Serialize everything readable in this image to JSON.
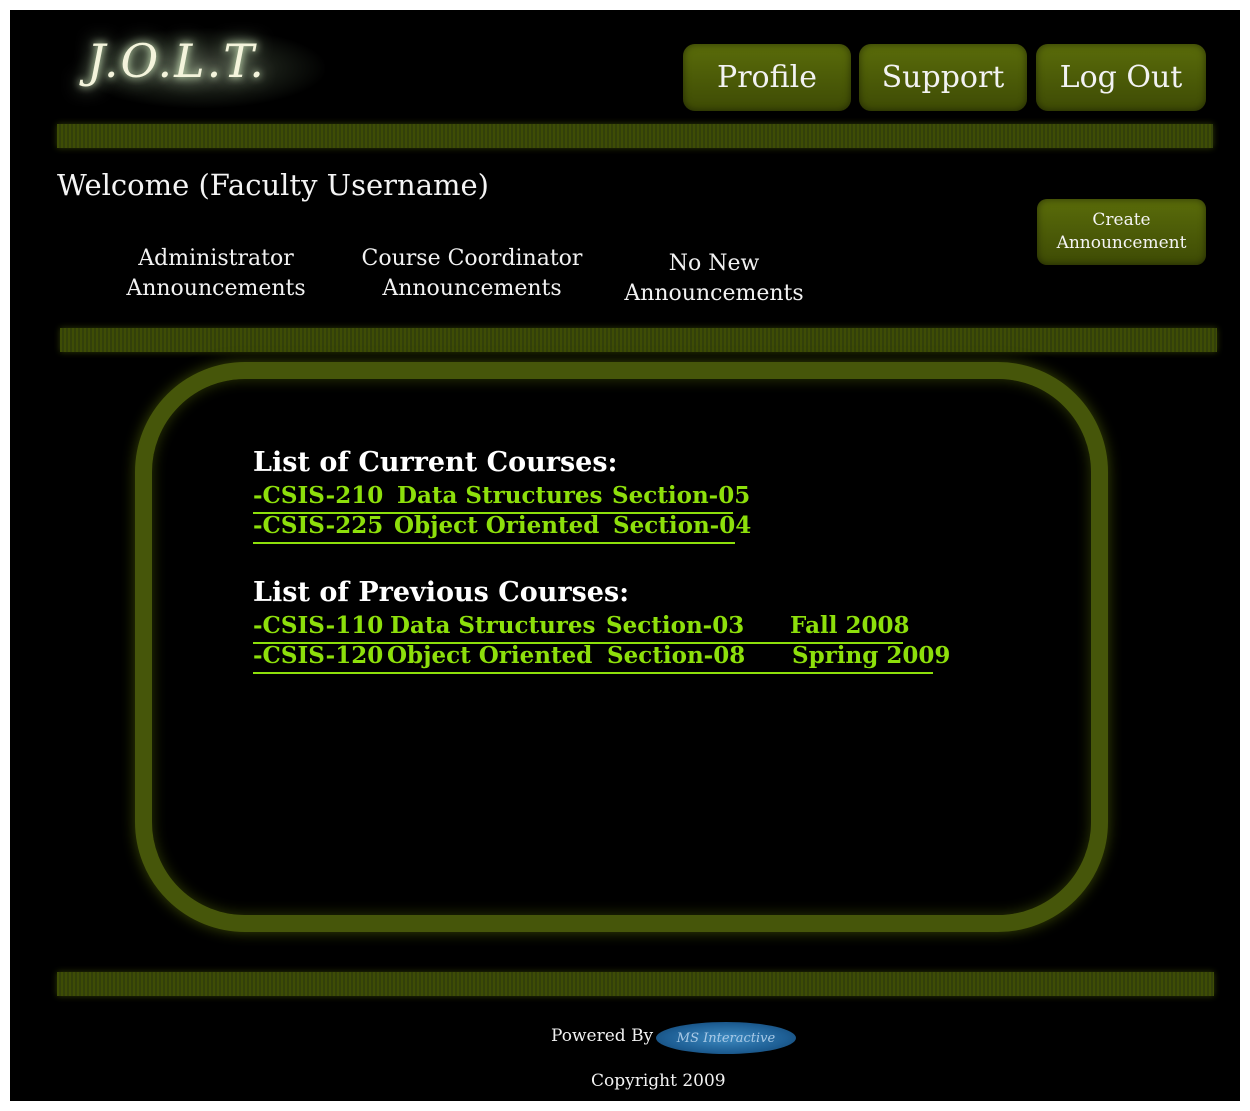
{
  "logo": {
    "text": "J.O.L.T."
  },
  "nav": {
    "profile": "Profile",
    "support": "Support",
    "logout": "Log Out"
  },
  "welcome": {
    "text": "Welcome (Faculty Username)"
  },
  "announcements": {
    "administrator": [
      "Administrator",
      "Announcements"
    ],
    "coordinator": [
      "Course Coordinator",
      "Announcements"
    ],
    "none": [
      "No New",
      "Announcements"
    ],
    "create_button": [
      "Create",
      "Announcement"
    ]
  },
  "courses": {
    "current_title": "List of Current Courses:",
    "current": [
      {
        "code": "-CSIS-210",
        "name": "Data Structures",
        "section": "Section-05"
      },
      {
        "code": "-CSIS-225",
        "name": "Object Oriented",
        "section": "Section-04"
      }
    ],
    "previous_title": "List of Previous Courses:",
    "previous": [
      {
        "code": "-CSIS-110",
        "name": "Data Structures",
        "section": "Section-03",
        "term": "Fall 2008"
      },
      {
        "code": "-CSIS-120",
        "name": "Object Oriented",
        "section": "Section-08",
        "term": "Spring 2009"
      }
    ]
  },
  "footer": {
    "powered_by": "Powered By",
    "badge_text": "MS Interactive",
    "copyright": "Copyright 2009"
  },
  "colors": {
    "background": "#000000",
    "accent": "#46560a",
    "link": "#8ddf0b",
    "text": "#f4f4f4"
  }
}
